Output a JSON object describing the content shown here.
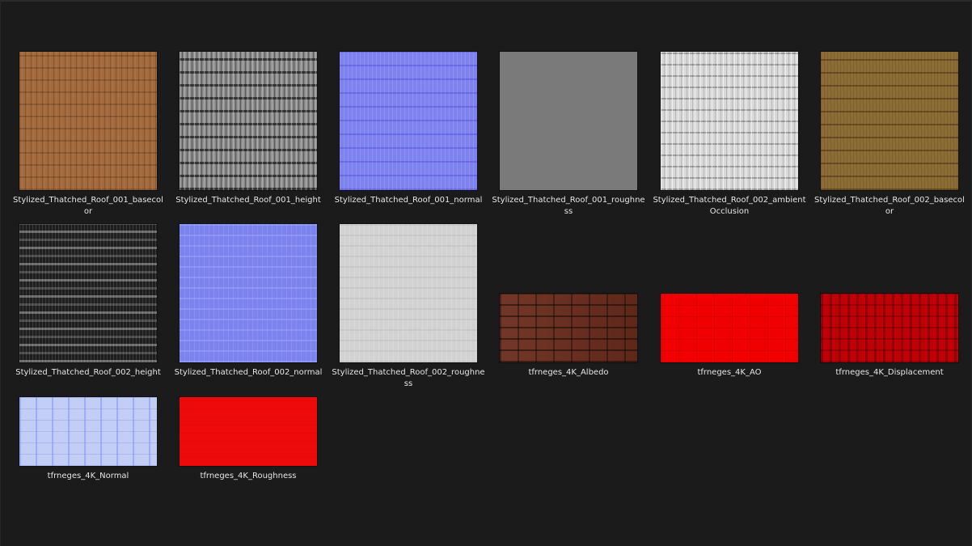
{
  "files": [
    {
      "name": "Stylized_Thatched_Roof_001_basecolor",
      "texture": "thatch-basecolor-brown"
    },
    {
      "name": "Stylized_Thatched_Roof_001_height",
      "texture": "thatch-height-grey"
    },
    {
      "name": "Stylized_Thatched_Roof_001_normal",
      "texture": "thatch-normal-blue"
    },
    {
      "name": "Stylized_Thatched_Roof_001_roughness",
      "texture": "flat-grey"
    },
    {
      "name": "Stylized_Thatched_Roof_002_ambientOcclusion",
      "texture": "thatch-ao-white"
    },
    {
      "name": "Stylized_Thatched_Roof_002_basecolor",
      "texture": "thatch-basecolor-gold"
    },
    {
      "name": "Stylized_Thatched_Roof_002_height",
      "texture": "thatch-height-dark"
    },
    {
      "name": "Stylized_Thatched_Roof_002_normal",
      "texture": "thatch-normal-blue"
    },
    {
      "name": "Stylized_Thatched_Roof_002_roughness",
      "texture": "thatch-roughness-light"
    },
    {
      "name": "tfrneges_4K_Albedo",
      "texture": "tile-albedo-brick"
    },
    {
      "name": "tfrneges_4K_AO",
      "texture": "tile-red"
    },
    {
      "name": "tfrneges_4K_Displacement",
      "texture": "tile-dark-red"
    },
    {
      "name": "tfrneges_4K_Normal",
      "texture": "tile-normal-light-blue"
    },
    {
      "name": "tfrneges_4K_Roughness",
      "texture": "tile-red"
    }
  ]
}
